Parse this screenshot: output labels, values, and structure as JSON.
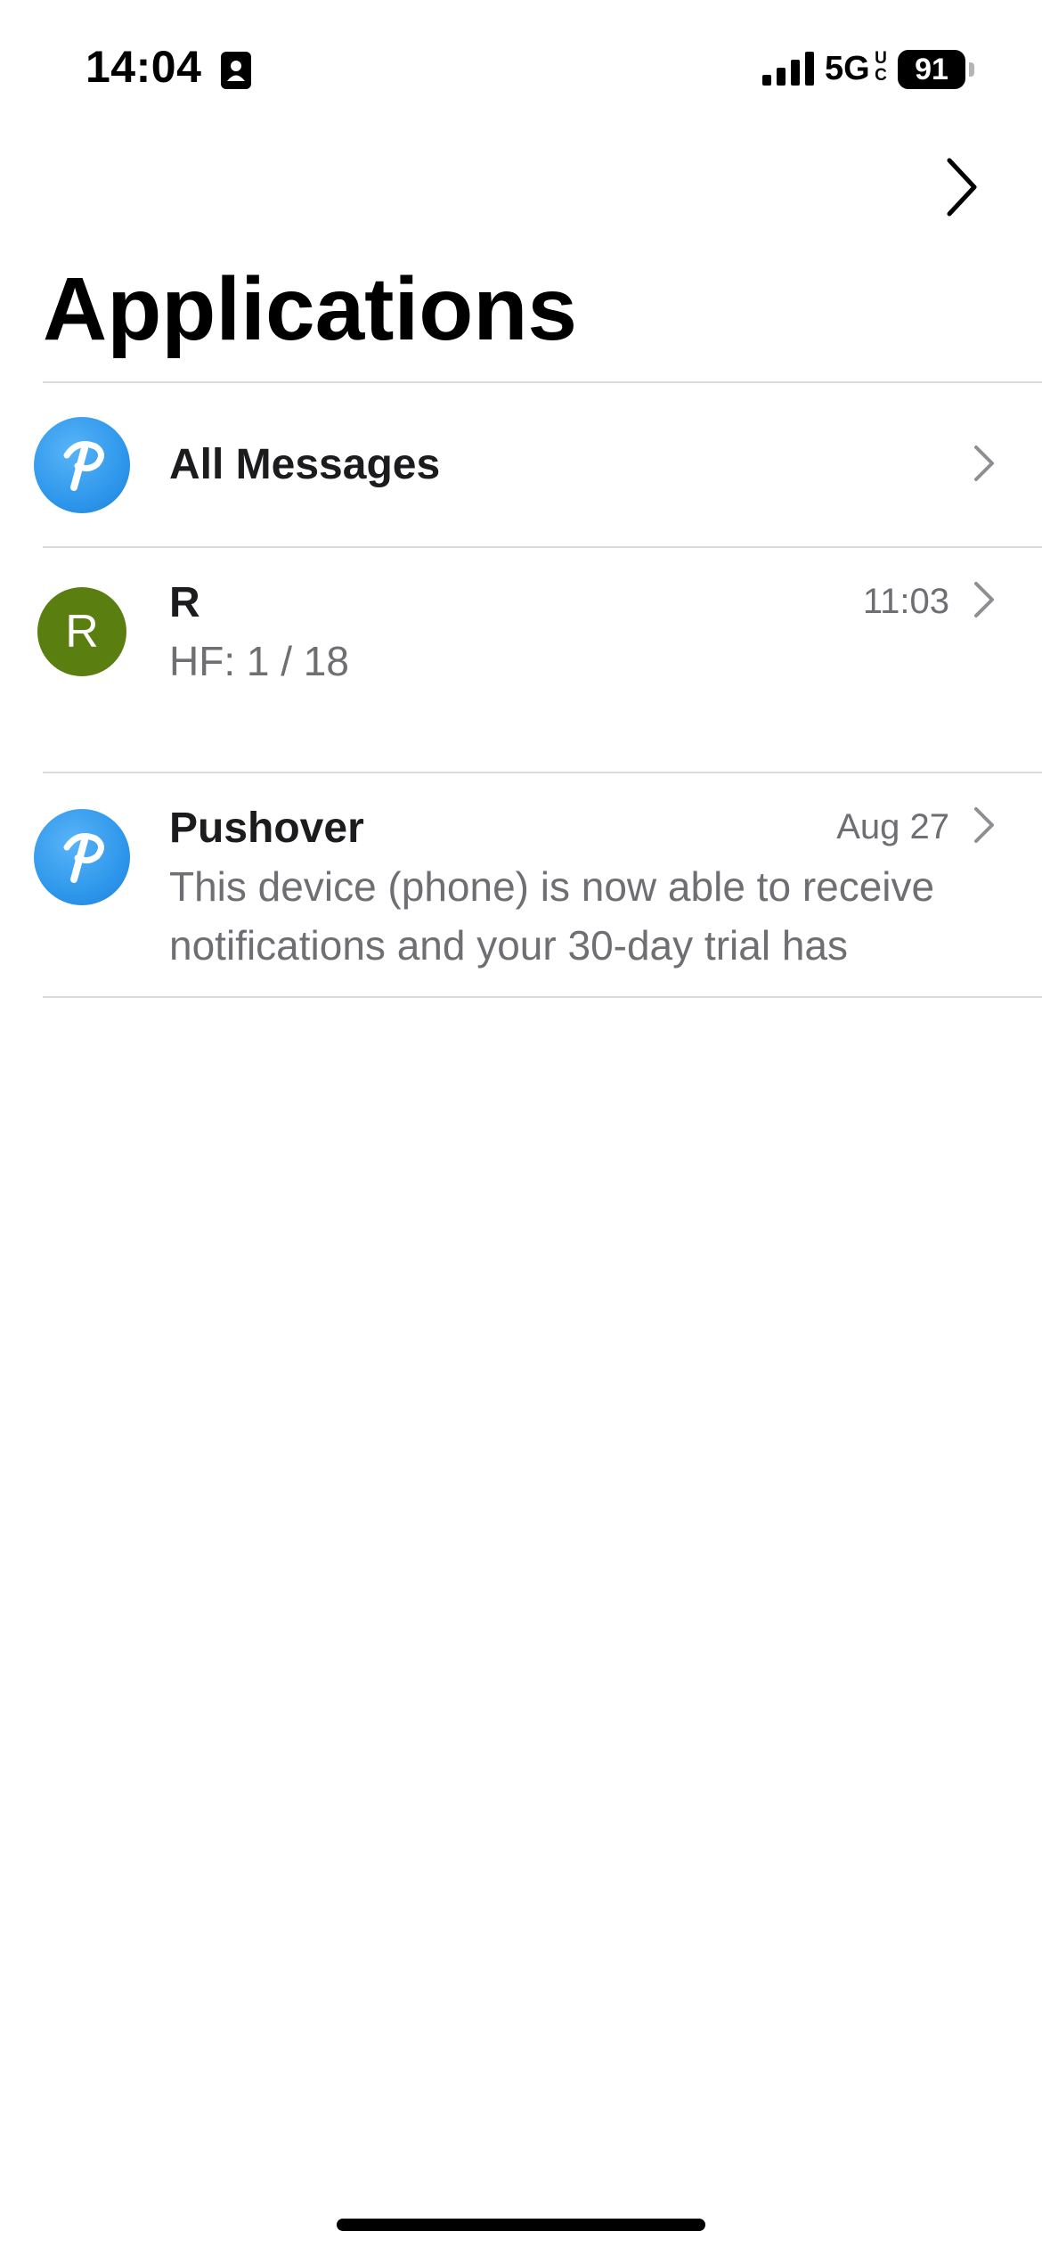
{
  "status_bar": {
    "time": "14:04",
    "network": "5G",
    "network_suffix_top": "U",
    "network_suffix_bottom": "C",
    "battery": "91",
    "icons": [
      "contact-card-icon",
      "signal-bars-icon",
      "battery-icon"
    ]
  },
  "nav": {
    "forward_icon": "chevron-right-icon",
    "title": "Applications"
  },
  "list": {
    "items": [
      {
        "avatar_icon": "pushover-logo-icon",
        "title": "All Messages",
        "time": "",
        "body": ""
      },
      {
        "avatar_letter": "R",
        "avatar_color": "#5a7f10",
        "title": "R",
        "time": "11:03",
        "body": "HF: 1 / 18"
      },
      {
        "avatar_icon": "pushover-logo-icon",
        "title": "Pushover",
        "time": "Aug 27",
        "body": "This device (phone) is now able to receive notifications and your 30-day trial has"
      }
    ]
  },
  "colors": {
    "accent_blue": "#2c95ea",
    "secondary_text": "#6e6e73",
    "separator": "#d9d9de"
  }
}
